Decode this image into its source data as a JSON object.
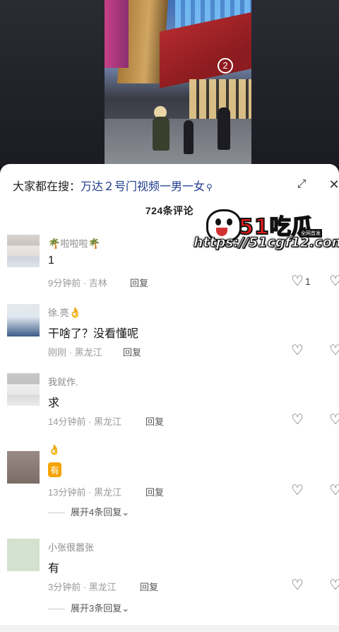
{
  "video": {
    "gate_number": "2"
  },
  "sheet": {
    "search_prefix": "大家都在搜：",
    "search_keyword": "万达２号门视频一男一女",
    "search_icon": "search-icon",
    "comment_count_label": "724条评论"
  },
  "watermark": {
    "title": "51吃瓜",
    "tag": "全网首发",
    "url": "https://51cgf12.com"
  },
  "comments": [
    {
      "user": "啦啦啦",
      "user_emoji": "🌴",
      "text": "1",
      "time": "9分钟前",
      "location": "吉林",
      "reply": "回复",
      "likes": "1",
      "more": ""
    },
    {
      "user": "徐.亮",
      "user_emoji": "👌",
      "text": "干啥了？没看懂呢",
      "time": "刚刚",
      "location": "黑龙江",
      "reply": "回复",
      "likes": "",
      "more": ""
    },
    {
      "user": "我就作.",
      "user_emoji": "",
      "text": "求",
      "time": "14分钟前",
      "location": "黑龙江",
      "reply": "回复",
      "likes": "",
      "more": ""
    },
    {
      "user": "",
      "user_emoji": "👌",
      "text": "有",
      "time": "13分钟前",
      "location": "黑龙江",
      "reply": "回复",
      "likes": "",
      "more": "展开4条回复"
    },
    {
      "user": "小张很嚣张",
      "user_emoji": "",
      "text": "有",
      "time": "3分钟前",
      "location": "黑龙江",
      "reply": "回复",
      "likes": "",
      "more": "展开3条回复"
    }
  ]
}
